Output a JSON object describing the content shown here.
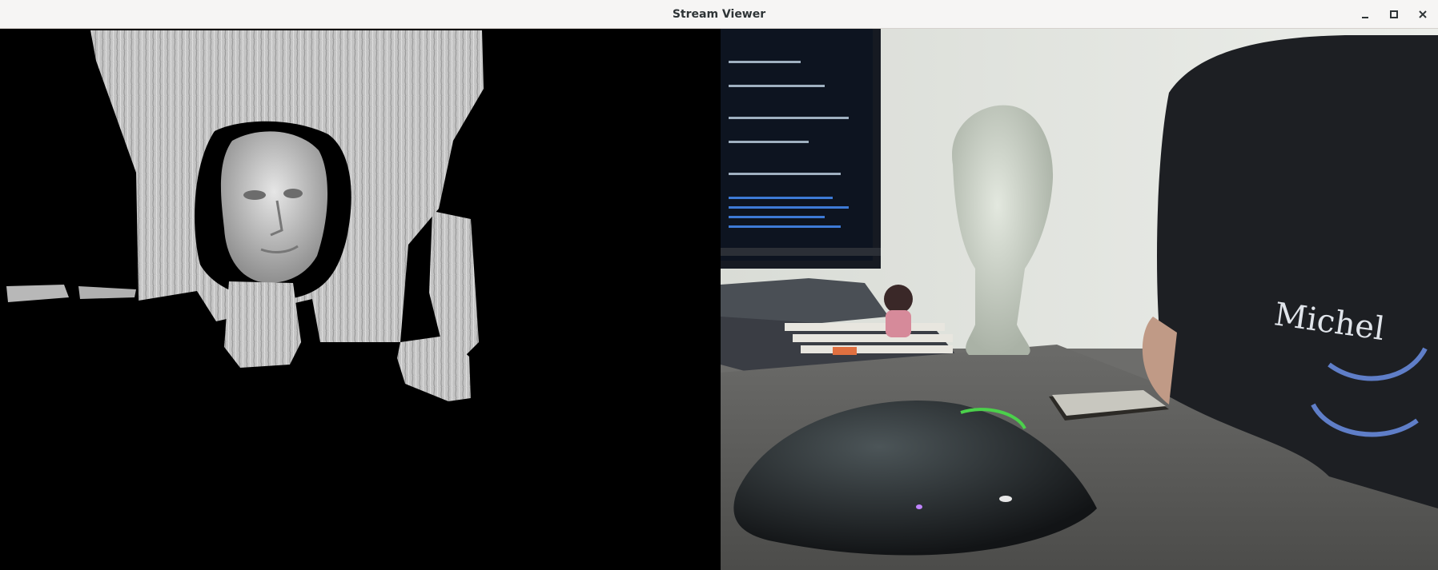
{
  "window": {
    "title": "Stream Viewer",
    "controls": {
      "minimize": "minimize-icon",
      "maximize": "maximize-icon",
      "close": "close-icon"
    }
  },
  "panes": {
    "left": {
      "kind": "depth-stream",
      "icon": "depth-frame"
    },
    "right": {
      "kind": "color-stream",
      "icon": "camera-frame"
    }
  },
  "colors": {
    "titlebar_bg": "#f6f5f4",
    "title_text": "#2e3436",
    "depth_bg": "#000000",
    "depth_surface": "#c8c8c8"
  }
}
